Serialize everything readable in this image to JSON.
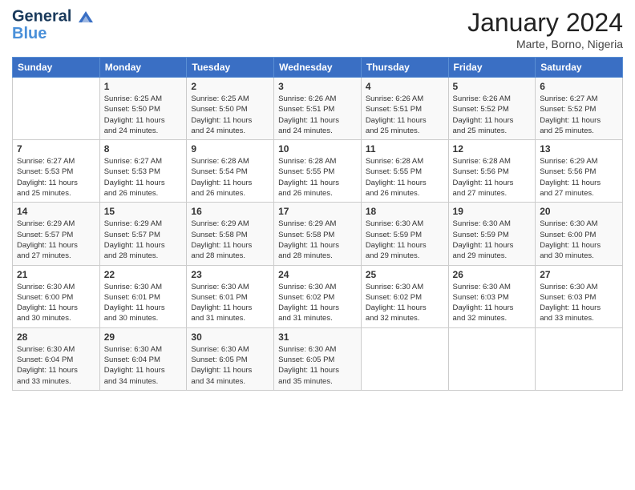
{
  "header": {
    "logo_line1": "General",
    "logo_line2": "Blue",
    "month": "January 2024",
    "location": "Marte, Borno, Nigeria"
  },
  "weekdays": [
    "Sunday",
    "Monday",
    "Tuesday",
    "Wednesday",
    "Thursday",
    "Friday",
    "Saturday"
  ],
  "weeks": [
    [
      {
        "day": "",
        "info": ""
      },
      {
        "day": "1",
        "info": "Sunrise: 6:25 AM\nSunset: 5:50 PM\nDaylight: 11 hours\nand 24 minutes."
      },
      {
        "day": "2",
        "info": "Sunrise: 6:25 AM\nSunset: 5:50 PM\nDaylight: 11 hours\nand 24 minutes."
      },
      {
        "day": "3",
        "info": "Sunrise: 6:26 AM\nSunset: 5:51 PM\nDaylight: 11 hours\nand 24 minutes."
      },
      {
        "day": "4",
        "info": "Sunrise: 6:26 AM\nSunset: 5:51 PM\nDaylight: 11 hours\nand 25 minutes."
      },
      {
        "day": "5",
        "info": "Sunrise: 6:26 AM\nSunset: 5:52 PM\nDaylight: 11 hours\nand 25 minutes."
      },
      {
        "day": "6",
        "info": "Sunrise: 6:27 AM\nSunset: 5:52 PM\nDaylight: 11 hours\nand 25 minutes."
      }
    ],
    [
      {
        "day": "7",
        "info": "Sunrise: 6:27 AM\nSunset: 5:53 PM\nDaylight: 11 hours\nand 25 minutes."
      },
      {
        "day": "8",
        "info": "Sunrise: 6:27 AM\nSunset: 5:53 PM\nDaylight: 11 hours\nand 26 minutes."
      },
      {
        "day": "9",
        "info": "Sunrise: 6:28 AM\nSunset: 5:54 PM\nDaylight: 11 hours\nand 26 minutes."
      },
      {
        "day": "10",
        "info": "Sunrise: 6:28 AM\nSunset: 5:55 PM\nDaylight: 11 hours\nand 26 minutes."
      },
      {
        "day": "11",
        "info": "Sunrise: 6:28 AM\nSunset: 5:55 PM\nDaylight: 11 hours\nand 26 minutes."
      },
      {
        "day": "12",
        "info": "Sunrise: 6:28 AM\nSunset: 5:56 PM\nDaylight: 11 hours\nand 27 minutes."
      },
      {
        "day": "13",
        "info": "Sunrise: 6:29 AM\nSunset: 5:56 PM\nDaylight: 11 hours\nand 27 minutes."
      }
    ],
    [
      {
        "day": "14",
        "info": "Sunrise: 6:29 AM\nSunset: 5:57 PM\nDaylight: 11 hours\nand 27 minutes."
      },
      {
        "day": "15",
        "info": "Sunrise: 6:29 AM\nSunset: 5:57 PM\nDaylight: 11 hours\nand 28 minutes."
      },
      {
        "day": "16",
        "info": "Sunrise: 6:29 AM\nSunset: 5:58 PM\nDaylight: 11 hours\nand 28 minutes."
      },
      {
        "day": "17",
        "info": "Sunrise: 6:29 AM\nSunset: 5:58 PM\nDaylight: 11 hours\nand 28 minutes."
      },
      {
        "day": "18",
        "info": "Sunrise: 6:30 AM\nSunset: 5:59 PM\nDaylight: 11 hours\nand 29 minutes."
      },
      {
        "day": "19",
        "info": "Sunrise: 6:30 AM\nSunset: 5:59 PM\nDaylight: 11 hours\nand 29 minutes."
      },
      {
        "day": "20",
        "info": "Sunrise: 6:30 AM\nSunset: 6:00 PM\nDaylight: 11 hours\nand 30 minutes."
      }
    ],
    [
      {
        "day": "21",
        "info": "Sunrise: 6:30 AM\nSunset: 6:00 PM\nDaylight: 11 hours\nand 30 minutes."
      },
      {
        "day": "22",
        "info": "Sunrise: 6:30 AM\nSunset: 6:01 PM\nDaylight: 11 hours\nand 30 minutes."
      },
      {
        "day": "23",
        "info": "Sunrise: 6:30 AM\nSunset: 6:01 PM\nDaylight: 11 hours\nand 31 minutes."
      },
      {
        "day": "24",
        "info": "Sunrise: 6:30 AM\nSunset: 6:02 PM\nDaylight: 11 hours\nand 31 minutes."
      },
      {
        "day": "25",
        "info": "Sunrise: 6:30 AM\nSunset: 6:02 PM\nDaylight: 11 hours\nand 32 minutes."
      },
      {
        "day": "26",
        "info": "Sunrise: 6:30 AM\nSunset: 6:03 PM\nDaylight: 11 hours\nand 32 minutes."
      },
      {
        "day": "27",
        "info": "Sunrise: 6:30 AM\nSunset: 6:03 PM\nDaylight: 11 hours\nand 33 minutes."
      }
    ],
    [
      {
        "day": "28",
        "info": "Sunrise: 6:30 AM\nSunset: 6:04 PM\nDaylight: 11 hours\nand 33 minutes."
      },
      {
        "day": "29",
        "info": "Sunrise: 6:30 AM\nSunset: 6:04 PM\nDaylight: 11 hours\nand 34 minutes."
      },
      {
        "day": "30",
        "info": "Sunrise: 6:30 AM\nSunset: 6:05 PM\nDaylight: 11 hours\nand 34 minutes."
      },
      {
        "day": "31",
        "info": "Sunrise: 6:30 AM\nSunset: 6:05 PM\nDaylight: 11 hours\nand 35 minutes."
      },
      {
        "day": "",
        "info": ""
      },
      {
        "day": "",
        "info": ""
      },
      {
        "day": "",
        "info": ""
      }
    ]
  ]
}
